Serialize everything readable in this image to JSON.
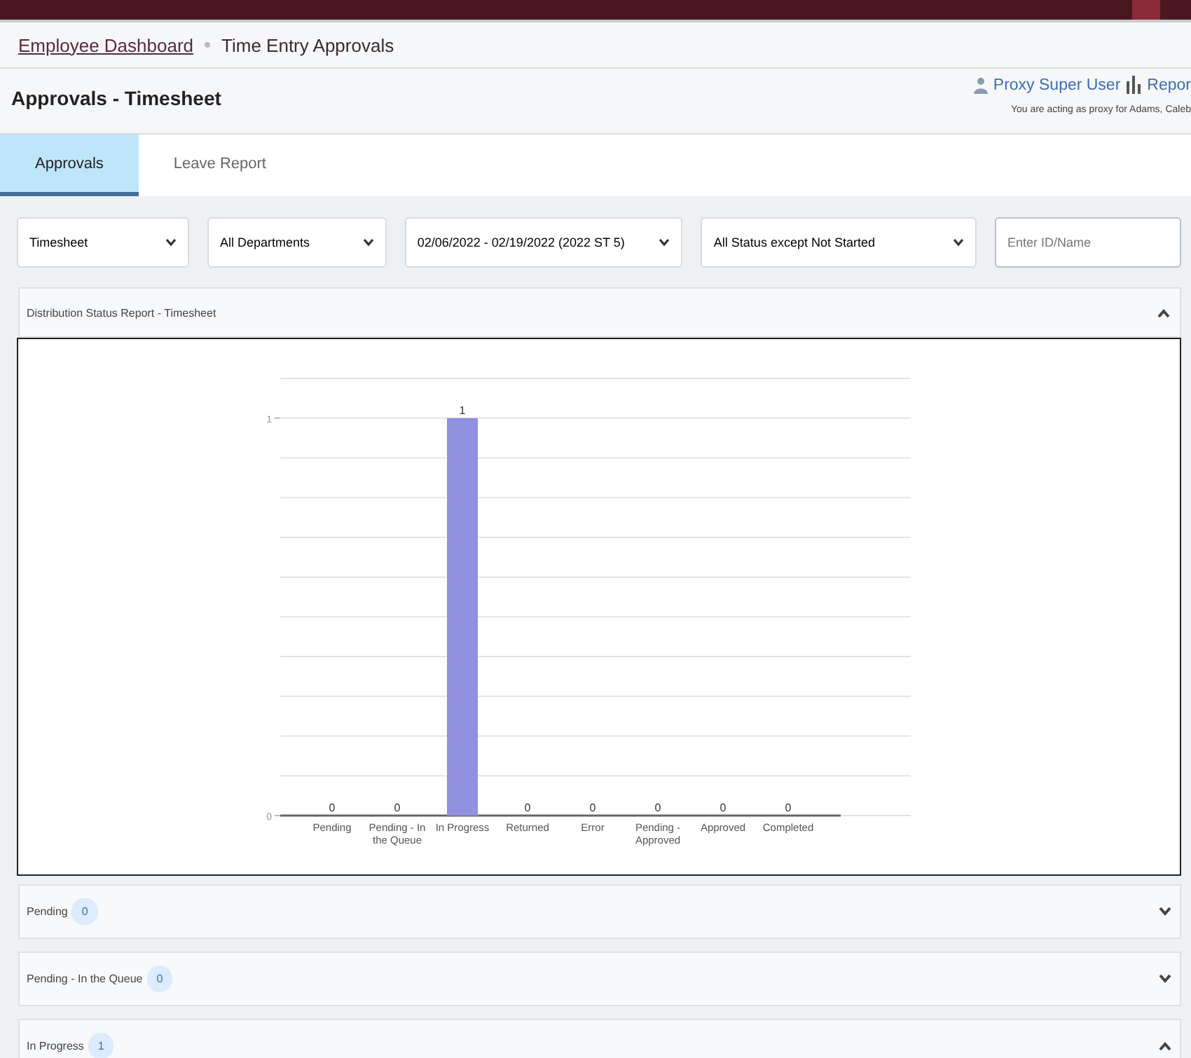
{
  "breadcrumb": [
    {
      "label": "Employee Dashboard",
      "kind": "link"
    },
    {
      "label": "Time Entry Approvals",
      "kind": "current"
    }
  ],
  "page_title": "Approvals - Timesheet",
  "proxy": {
    "user_link": "Proxy Super User",
    "reports_link": "Repor",
    "note": "You are acting as proxy for Adams, Caleb"
  },
  "tabs": [
    {
      "label": "Approvals",
      "selected": true
    },
    {
      "label": "Leave Report",
      "selected": false
    }
  ],
  "filters": [
    {
      "kind": "select",
      "value": "Timesheet"
    },
    {
      "kind": "select",
      "value": "All Departments"
    },
    {
      "kind": "select",
      "value": "02/06/2022 - 02/19/2022 (2022 ST 5)"
    },
    {
      "kind": "select",
      "value": "All Status except Not Started"
    },
    {
      "kind": "input",
      "placeholder": "Enter ID/Name"
    }
  ],
  "report_panel": {
    "title": "Distribution Status Report - Timesheet",
    "expanded": true,
    "chart_data": {
      "type": "bar",
      "categories": [
        "Pending",
        "Pending - In the Queue",
        "In Progress",
        "Returned",
        "Error",
        "Pending - Approved",
        "Approved",
        "Completed"
      ],
      "values": [
        0,
        0,
        1,
        0,
        0,
        0,
        0,
        0
      ],
      "ylim": [
        0,
        1.1
      ],
      "yticks": [
        0,
        1
      ],
      "data_labels": true
    }
  },
  "sections": [
    {
      "title": "Pending",
      "count": "0",
      "expanded": false
    },
    {
      "title": "Pending - In the Queue",
      "count": "0",
      "expanded": false
    },
    {
      "title": "In Progress",
      "count": "1",
      "expanded": true
    }
  ]
}
